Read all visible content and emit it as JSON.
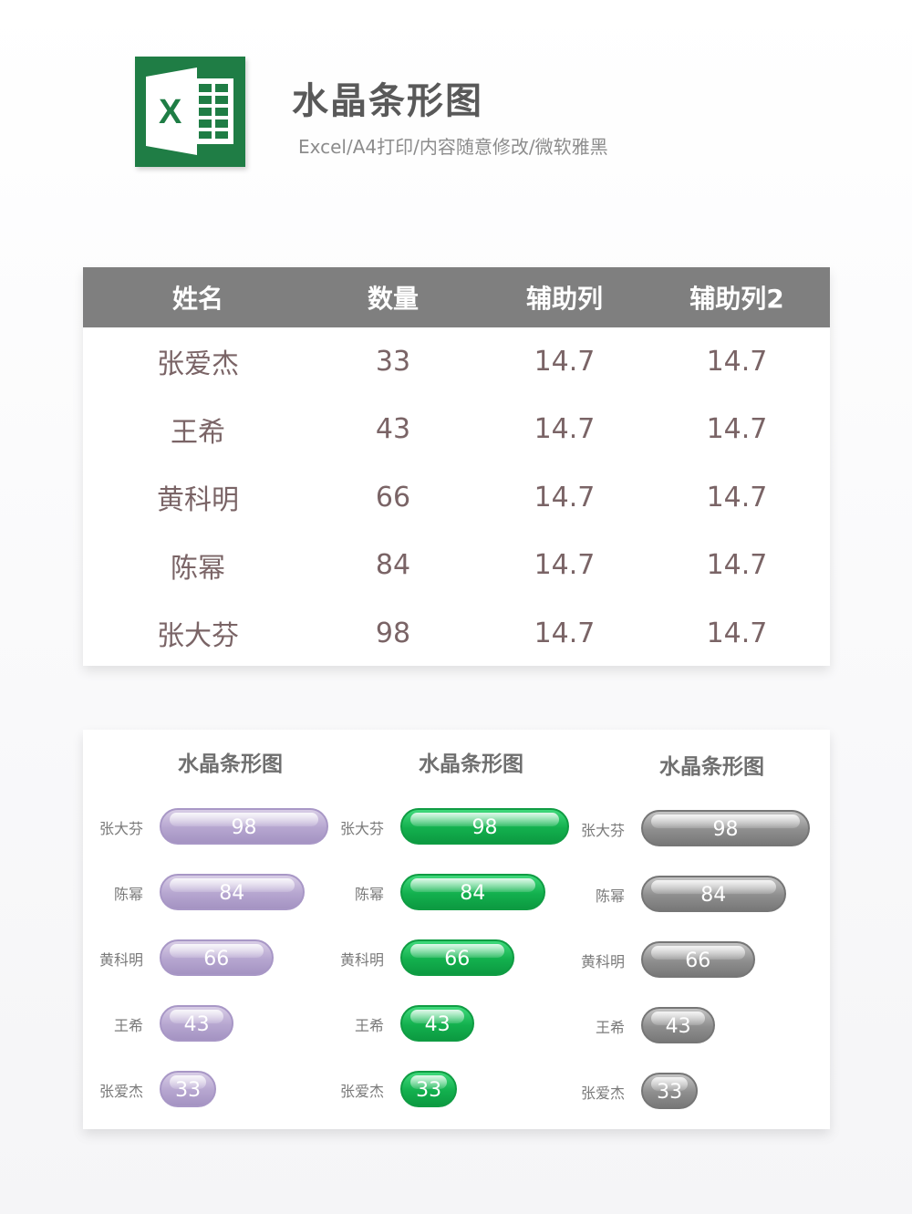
{
  "header": {
    "logo_letter": "X",
    "title": "水晶条形图",
    "subtitle": "Excel/A4打印/内容随意修改/微软雅黑"
  },
  "table": {
    "headers": [
      "姓名",
      "数量",
      "辅助列",
      "辅助列2"
    ],
    "rows": [
      [
        "张爱杰",
        "33",
        "14.7",
        "14.7"
      ],
      [
        "王希",
        "43",
        "14.7",
        "14.7"
      ],
      [
        "黄科明",
        "66",
        "14.7",
        "14.7"
      ],
      [
        "陈幂",
        "84",
        "14.7",
        "14.7"
      ],
      [
        "张大芬",
        "98",
        "14.7",
        "14.7"
      ]
    ]
  },
  "colors": {
    "logo": "#1f7d45",
    "table_header": "#7f7f7f",
    "purple": "#b6a6d0",
    "green": "#13b04e",
    "gray": "#8e8e8e"
  },
  "chart_data": [
    {
      "type": "bar",
      "orientation": "horizontal",
      "title": "水晶条形图",
      "color": "purple",
      "categories": [
        "张大芬",
        "陈幂",
        "黄科明",
        "王希",
        "张爱杰"
      ],
      "values": [
        98,
        84,
        66,
        43,
        33
      ],
      "grid": false,
      "legend": "none"
    },
    {
      "type": "bar",
      "orientation": "horizontal",
      "title": "水晶条形图",
      "color": "green",
      "categories": [
        "张大芬",
        "陈幂",
        "黄科明",
        "王希",
        "张爱杰"
      ],
      "values": [
        98,
        84,
        66,
        43,
        33
      ],
      "grid": false,
      "legend": "none"
    },
    {
      "type": "bar",
      "orientation": "horizontal",
      "title": "水晶条形图",
      "color": "gray",
      "categories": [
        "张大芬",
        "陈幂",
        "黄科明",
        "王希",
        "张爱杰"
      ],
      "values": [
        98,
        84,
        66,
        43,
        33
      ],
      "grid": false,
      "legend": "none"
    }
  ]
}
